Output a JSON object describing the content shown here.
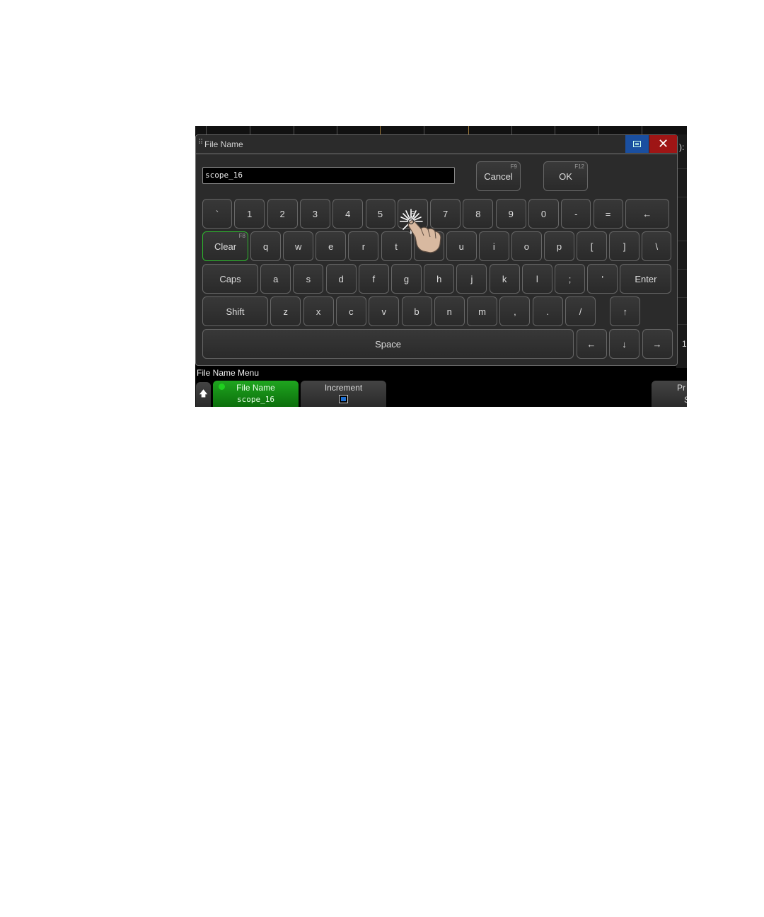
{
  "dialog": {
    "title": "File Name",
    "close_glyph": "✕",
    "menu_icon": "menu-icon",
    "filename_value": "scope_16",
    "cancel": {
      "label": "Cancel",
      "fkey": "F9"
    },
    "ok": {
      "label": "OK",
      "fkey": "F12"
    }
  },
  "keyboard": {
    "row1": [
      "`",
      "1",
      "2",
      "3",
      "4",
      "5",
      "6",
      "7",
      "8",
      "9",
      "0",
      "-",
      "=",
      "←"
    ],
    "row2": [
      "Clear",
      "q",
      "w",
      "e",
      "r",
      "t",
      "y",
      "u",
      "i",
      "o",
      "p",
      "[",
      "]",
      "\\"
    ],
    "clear_fkey": "F8",
    "row3": [
      "Caps",
      "a",
      "s",
      "d",
      "f",
      "g",
      "h",
      "j",
      "k",
      "l",
      ";",
      "'",
      "Enter"
    ],
    "row4": [
      "Shift",
      "z",
      "x",
      "c",
      "v",
      "b",
      "n",
      "m",
      ",",
      ".",
      "/",
      "↑"
    ],
    "row5": [
      "Space",
      "←",
      "↓",
      "→"
    ]
  },
  "menu": {
    "title": "File Name Menu",
    "up_glyph": "🡅",
    "file_name_label": "File Name",
    "file_name_value": "scope_16",
    "increment_label": "Increment",
    "increment_checked": true,
    "partial_label_top": "Pr",
    "partial_label_bottom": "S"
  },
  "background": {
    "right_text_1": "):",
    "right_text_2": "1"
  },
  "colors": {
    "accent_green": "#1fa51f",
    "close_red": "#9e1515",
    "menu_blue": "#1a4fa0"
  }
}
